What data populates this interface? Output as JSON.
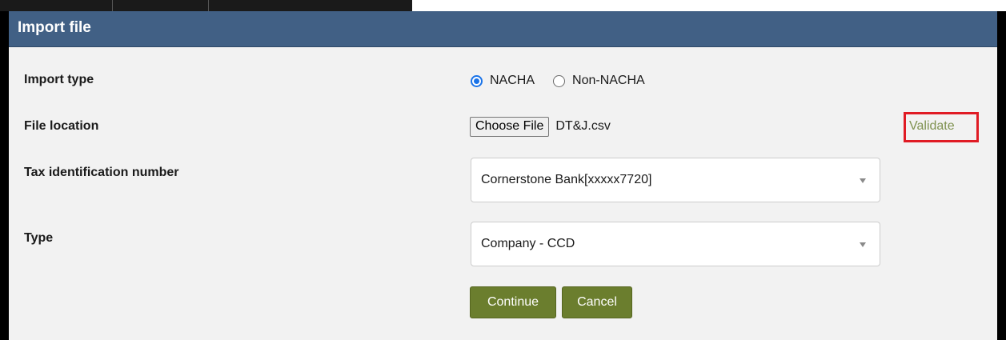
{
  "dialog": {
    "title": "Import file"
  },
  "import_type": {
    "label": "Import type",
    "options": [
      {
        "label": "NACHA",
        "selected": true
      },
      {
        "label": "Non-NACHA",
        "selected": false
      }
    ]
  },
  "file_location": {
    "label": "File location",
    "button_label": "Choose File",
    "file_name": "DT&J.csv",
    "validate_label": "Validate"
  },
  "tax_id": {
    "label": "Tax identification number",
    "selected": "Cornerstone Bank[xxxxx7720]"
  },
  "type": {
    "label": "Type",
    "selected": "Company - CCD"
  },
  "actions": {
    "continue_label": "Continue",
    "cancel_label": "Cancel"
  },
  "colors": {
    "header": "#416085",
    "button": "#6b7e2e",
    "validate_text": "#7f9250",
    "highlight": "#e01b24",
    "radio_accent": "#1a73e8"
  }
}
